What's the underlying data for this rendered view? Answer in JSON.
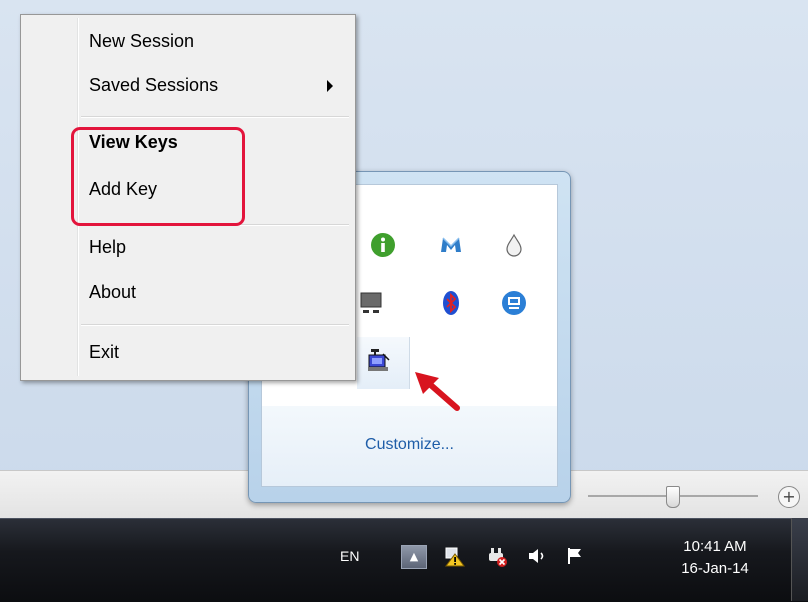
{
  "context_menu": {
    "items": [
      {
        "label": "New Session"
      },
      {
        "label": "Saved Sessions",
        "has_submenu": true
      },
      {
        "label": "View Keys",
        "bold": true
      },
      {
        "label": "Add Key"
      },
      {
        "label": "Help"
      },
      {
        "label": "About"
      },
      {
        "label": "Exit"
      }
    ]
  },
  "tray_flyout": {
    "customize_label": "Customize...",
    "icons": [
      "info-icon",
      "malwarebytes-icon",
      "water-drop-icon",
      "network-monitor-icon",
      "bluetooth-icon",
      "remote-desktop-icon",
      "pageant-icon"
    ]
  },
  "taskbar": {
    "language": "EN",
    "clock": {
      "time": "10:41 AM",
      "date": "16-Jan-14"
    },
    "tray_icons": [
      "action-center-warning-icon",
      "power-plug-error-icon",
      "volume-icon",
      "flag-icon"
    ]
  },
  "colors": {
    "highlight": "#e3143c",
    "link": "#1e5da8",
    "taskbar": "#16181d"
  }
}
